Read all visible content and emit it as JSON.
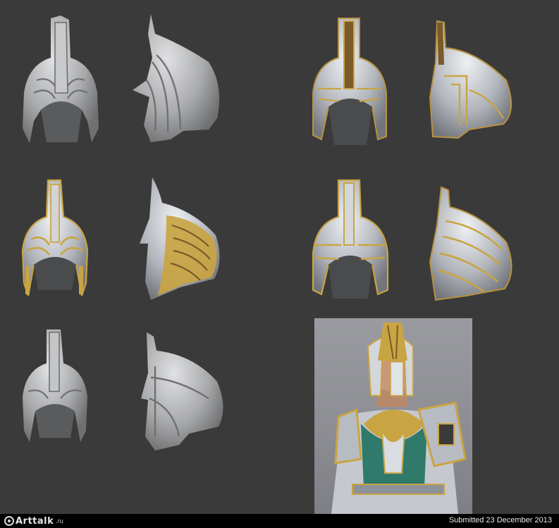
{
  "sheet": {
    "background": "#3a3a3a",
    "views": [
      {
        "name": "clay-front-a",
        "kind": "clay"
      },
      {
        "name": "clay-side-a",
        "kind": "clay"
      },
      {
        "name": "painted-front-a",
        "kind": "painted"
      },
      {
        "name": "painted-side-a",
        "kind": "painted"
      },
      {
        "name": "gold-front",
        "kind": "gold"
      },
      {
        "name": "gold-side-winged",
        "kind": "gold"
      },
      {
        "name": "painted-front-b",
        "kind": "painted"
      },
      {
        "name": "painted-side-b",
        "kind": "painted"
      },
      {
        "name": "clay-front-b",
        "kind": "clay"
      },
      {
        "name": "clay-side-b",
        "kind": "clay"
      }
    ],
    "colors": {
      "clay": "#b9babc",
      "steel": "#a9adb3",
      "gold": "#c9a443",
      "dark": "#2a2a2a"
    }
  },
  "render": {
    "subject": "armored knight character render",
    "background": "#8e8f94"
  },
  "footer": {
    "logo_text": "Arttalk",
    "logo_suffix": ".ru",
    "submitted": "Submitted 23 December 2013"
  }
}
